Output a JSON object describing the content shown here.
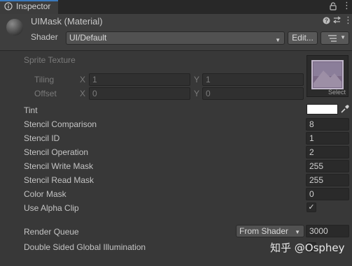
{
  "tab": {
    "label": "Inspector"
  },
  "material": {
    "title": "UIMask (Material)"
  },
  "shader": {
    "label": "Shader",
    "value": "UI/Default",
    "edit_label": "Edit..."
  },
  "texture": {
    "label": "Sprite Texture",
    "select_label": "Select",
    "tiling": {
      "label": "Tiling",
      "x_label": "X",
      "x": "1",
      "y_label": "Y",
      "y": "1"
    },
    "offset": {
      "label": "Offset",
      "x_label": "X",
      "x": "0",
      "y_label": "Y",
      "y": "0"
    }
  },
  "props": [
    {
      "label": "Tint",
      "value": ""
    },
    {
      "label": "Stencil Comparison",
      "value": "8"
    },
    {
      "label": "Stencil ID",
      "value": "1"
    },
    {
      "label": "Stencil Operation",
      "value": "2"
    },
    {
      "label": "Stencil Write Mask",
      "value": "255"
    },
    {
      "label": "Stencil Read Mask",
      "value": "255"
    },
    {
      "label": "Color Mask",
      "value": "0"
    },
    {
      "label": "Use Alpha Clip",
      "value": "✓"
    }
  ],
  "render_queue": {
    "label": "Render Queue",
    "mode": "From Shader",
    "value": "3000"
  },
  "gi": {
    "label": "Double Sided Global Illumination"
  },
  "watermark": "知乎 @Osphey",
  "colors": {
    "background": "#383838",
    "tint": "#ffffff",
    "tab_accent": "#3a79bb"
  }
}
